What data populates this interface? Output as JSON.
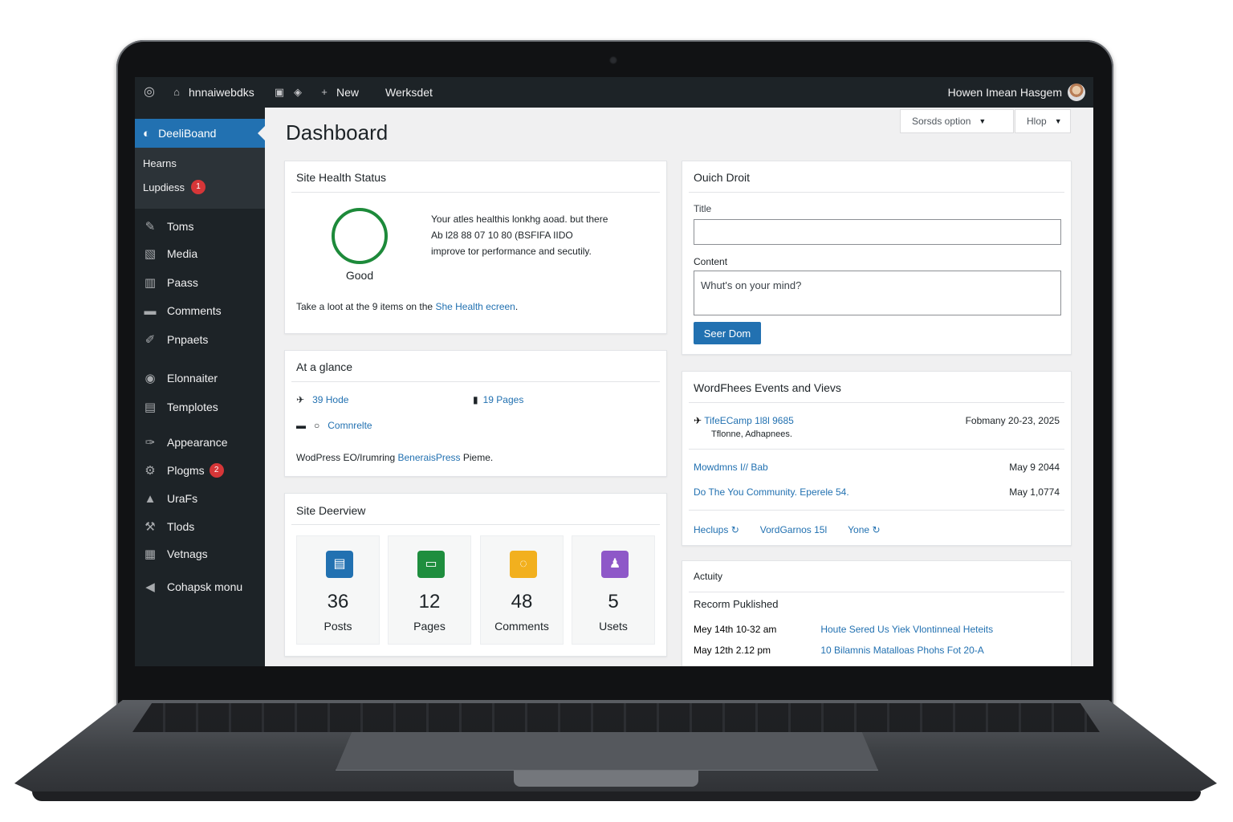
{
  "adminbar": {
    "site_name": "hnnaiwebdks",
    "new_label": "New",
    "workspace_label": "Werksdet",
    "user_greeting": "Howen Imean Hasgem"
  },
  "sidebar": {
    "active": "DeeliBoand",
    "submenu": [
      {
        "label": "Hearns"
      },
      {
        "label": "Lupdiess",
        "badge": "1"
      }
    ],
    "items": [
      {
        "label": "Toms",
        "icon": "pin-icon"
      },
      {
        "label": "Media",
        "icon": "media-icon"
      },
      {
        "label": "Paass",
        "icon": "pages-icon"
      },
      {
        "label": "Comments",
        "icon": "comments-icon"
      },
      {
        "label": "Pnpaets",
        "icon": "projects-icon"
      },
      {
        "label": "Elonnaiter",
        "icon": "elementor-icon"
      },
      {
        "label": "Templotes",
        "icon": "templates-icon"
      },
      {
        "label": "Appearance",
        "icon": "appearance-icon"
      },
      {
        "label": "Plogms",
        "icon": "plugins-icon",
        "badge": "2"
      },
      {
        "label": "UraFs",
        "icon": "users-icon"
      },
      {
        "label": "Tlods",
        "icon": "tools-icon"
      },
      {
        "label": "Vetnags",
        "icon": "settings-icon"
      },
      {
        "label": "Cohapsk monu",
        "icon": "collapse-icon"
      }
    ]
  },
  "page": {
    "title": "Dashboard",
    "screen_options": "Sorsds option",
    "help": "Hlop"
  },
  "site_health": {
    "title": "Site Health Status",
    "status": "Good",
    "message_line1": "Your atles healthis lonkhg aoad. but there",
    "message_line2": "Ab l28 88 07 10 80 (BSFIFA IIDO",
    "message_line3": "improve tor performance and secutily.",
    "footer_prefix": "Take a loot at the 9 items on the",
    "footer_link": "She Health ecreen",
    "footer_suffix": "."
  },
  "at_a_glance": {
    "title": "At a glance",
    "posts": "39 Hode",
    "pages": "19 Pages",
    "comments": "Comnrelte",
    "footer_prefix": "WodPress EO/Irumring",
    "footer_link": "BeneraisPress",
    "footer_suffix": "Pieme."
  },
  "site_overview": {
    "title": "Site Deerview",
    "stats": [
      {
        "value": "36",
        "label": "Posts",
        "icon": "posts-icon",
        "color": "#2271b1"
      },
      {
        "value": "12",
        "label": "Pages",
        "icon": "pages-icon",
        "color": "#1e8e3e"
      },
      {
        "value": "48",
        "label": "Comments",
        "icon": "comments-icon",
        "color": "#f2b01e"
      },
      {
        "value": "5",
        "label": "Usets",
        "icon": "users-icon",
        "color": "#8e58c8"
      }
    ]
  },
  "quick_draft": {
    "title": "Ouich Droit",
    "title_label": "Title",
    "content_label": "Content",
    "content_placeholder": "Whut's on your mind?",
    "save_button": "Seer Dom"
  },
  "events": {
    "title": "WordFhees Events and Vievs",
    "items": [
      {
        "name": "TifeECamp 1l8l 9685",
        "sub": "Tflonne, Adhapnees.",
        "date": "Fobmany 20-23, 2025"
      },
      {
        "name": "Mowdmns I// Bab",
        "date": "May 9 2044"
      },
      {
        "name": "Do The You Community. Eperele 54.",
        "date": "May 1,0774"
      }
    ],
    "links": [
      "Heclups",
      "VordGarnos 15l",
      "Yone"
    ]
  },
  "activity": {
    "title": "Actuity",
    "subtitle": "Recorm Puklished",
    "items": [
      {
        "date": "Mey 14th 10-32 am",
        "title": "Houte Sered Us Yiek Vlontinneal Heteits"
      },
      {
        "date": "May 12th 2.12 pm",
        "title": "10 Bilamnis Matalloas Phohs Fot 20-A"
      }
    ]
  },
  "colors": {
    "admin_dark": "#1d2327",
    "accent_blue": "#2271b1",
    "health_green": "#1d8a3a",
    "badge_red": "#d63638"
  }
}
